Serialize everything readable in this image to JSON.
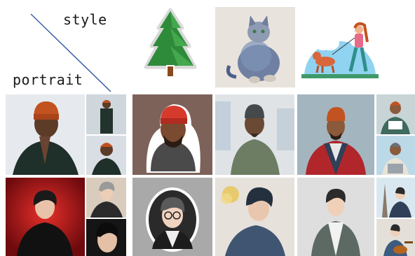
{
  "header": {
    "style_label": "style",
    "portrait_label": "portrait"
  },
  "style_references": [
    {
      "icon": "pine-tree-sticker-icon"
    },
    {
      "icon": "watercolor-cat-icon"
    },
    {
      "icon": "woman-walking-dog-icon"
    }
  ],
  "rows": [
    {
      "portrait": "man-orange-beanie",
      "outputs": [
        "sticker",
        "watercolor",
        "flat-illustration"
      ]
    },
    {
      "portrait": "asian-man-black-jacket",
      "outputs": [
        "sticker",
        "watercolor",
        "flat-illustration"
      ]
    }
  ],
  "colors": {
    "diagonal_line": "#3b5fa8",
    "beanie_orange": "#c2521f",
    "tree_green": "#2e8b3a",
    "dog_orange": "#d9673b"
  }
}
